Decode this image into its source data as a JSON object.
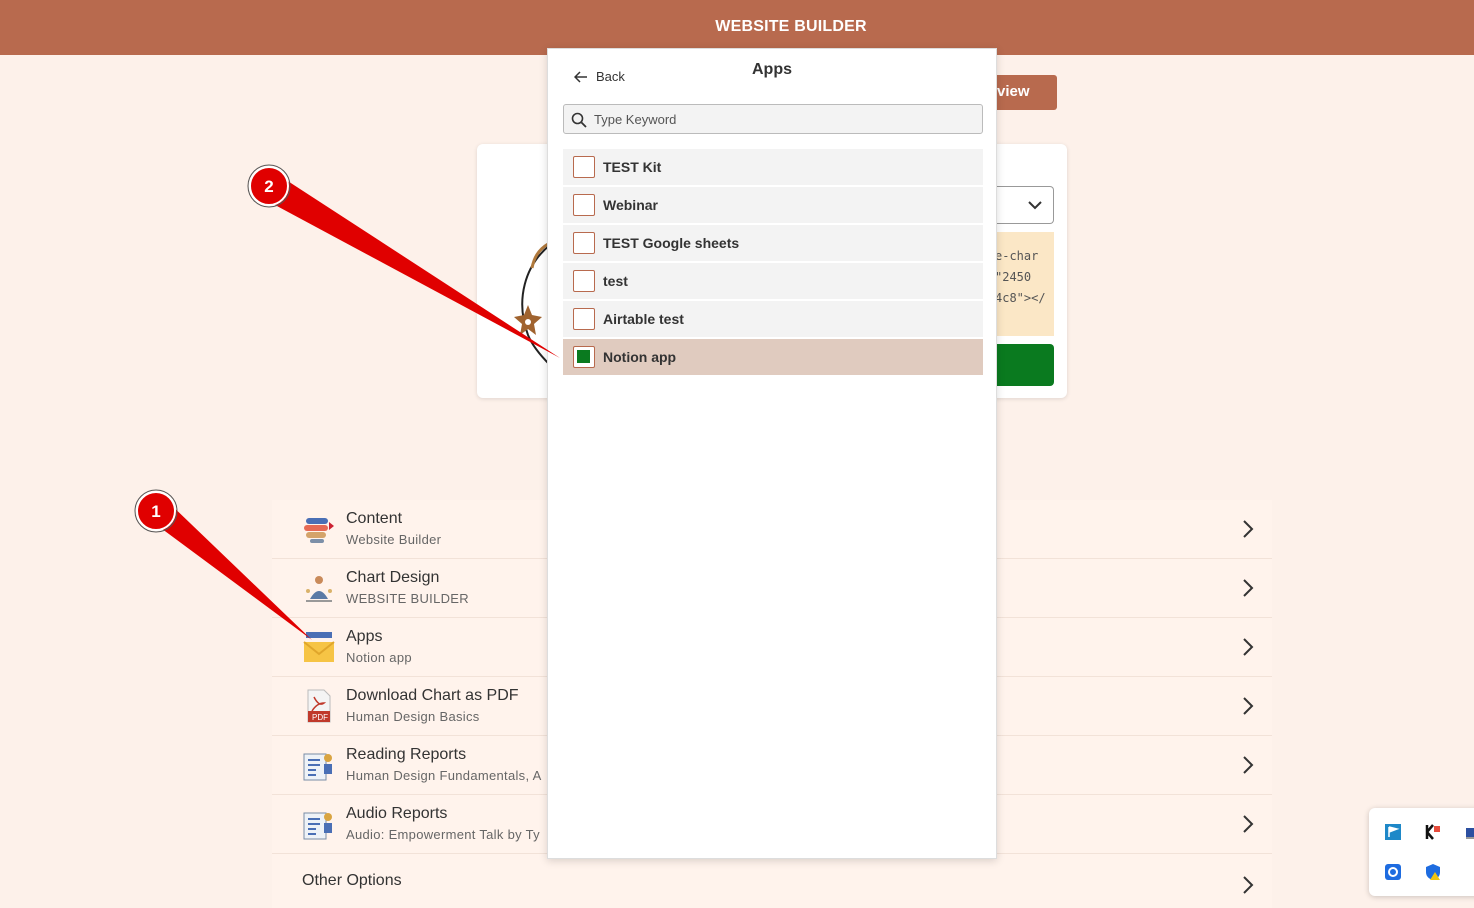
{
  "header": {
    "title": "WEBSITE BUILDER"
  },
  "preview_button": {
    "label": "view"
  },
  "card": {
    "code_lines": [
      "e-char",
      "\"2450",
      "4c8\"></"
    ]
  },
  "panel": {
    "back_label": "Back",
    "title": "Apps",
    "search_placeholder": "Type Keyword",
    "items": [
      {
        "label": "TEST Kit",
        "checked": false
      },
      {
        "label": "Webinar",
        "checked": false
      },
      {
        "label": "TEST Google sheets",
        "checked": false
      },
      {
        "label": "test",
        "checked": false
      },
      {
        "label": "Airtable test",
        "checked": false
      },
      {
        "label": "Notion app",
        "checked": true
      }
    ]
  },
  "list": {
    "rows": [
      {
        "title": "Content",
        "sub": "Website Builder",
        "icon": "content-icon"
      },
      {
        "title": "Chart Design",
        "sub": "WEBSITE BUILDER",
        "icon": "chart-design-icon"
      },
      {
        "title": "Apps",
        "sub": "Notion app",
        "icon": "envelope-icon"
      },
      {
        "title": "Download Chart as PDF",
        "sub": "Human Design Basics",
        "icon": "pdf-icon"
      },
      {
        "title": "Reading Reports",
        "sub": "Human Design Fundamentals, A",
        "icon": "report-icon"
      },
      {
        "title": "Audio Reports",
        "sub": "Audio: Empowerment Talk by Ty",
        "icon": "report-icon"
      }
    ],
    "other_options": "Other Options"
  },
  "annotations": {
    "marker_1": "1",
    "marker_2": "2"
  },
  "colors": {
    "brand": "#b86a4e",
    "background": "#fdf1ea",
    "selected_row": "#e0cbbf",
    "check_fill": "#0a7a1f"
  }
}
